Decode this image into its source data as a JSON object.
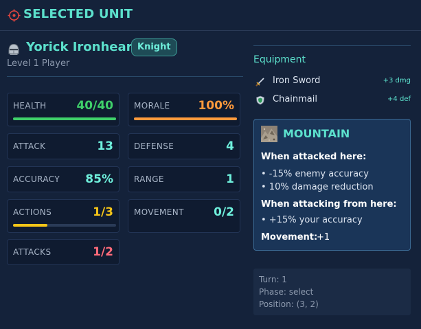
{
  "header": {
    "title": "SELECTED UNIT",
    "icon": "target-icon"
  },
  "unit": {
    "name": "Yorick Ironheart",
    "class_badge": "Knight",
    "subtitle": "Level 1 Player",
    "icon": "helmet-icon"
  },
  "stats": {
    "health": {
      "label": "HEALTH",
      "value": "40/40",
      "fraction": 1.0,
      "color": "#3fd06a"
    },
    "morale": {
      "label": "MORALE",
      "value": "100%",
      "fraction": 1.0,
      "color": "#ff9a3c"
    },
    "attack": {
      "label": "ATTACK",
      "value": "13",
      "color": "#6ff0dc"
    },
    "defense": {
      "label": "DEFENSE",
      "value": "4",
      "color": "#6ff0dc"
    },
    "accuracy": {
      "label": "ACCURACY",
      "value": "85%",
      "color": "#6ff0dc"
    },
    "range": {
      "label": "RANGE",
      "value": "1",
      "color": "#6ff0dc"
    },
    "actions": {
      "label": "ACTIONS",
      "value": "1/3",
      "fraction": 0.333,
      "color": "#f5c518"
    },
    "movement": {
      "label": "MOVEMENT",
      "value": "0/2",
      "color": "#6ff0dc"
    },
    "attacks": {
      "label": "ATTACKS",
      "value": "1/2",
      "color": "#ff6b7a"
    }
  },
  "equipment": {
    "title": "Equipment",
    "items": [
      {
        "name": "Iron Sword",
        "bonus": "+3 dmg",
        "icon": "sword-icon"
      },
      {
        "name": "Chainmail",
        "bonus": "+4 def",
        "icon": "shield-icon"
      }
    ]
  },
  "terrain": {
    "name": "MOUNTAIN",
    "icon": "mountain-tile-icon",
    "attacked_heading": "When attacked here:",
    "attacked_items": [
      "• -15% enemy accuracy",
      "• 10% damage reduction"
    ],
    "attacking_heading": "When attacking from here:",
    "attacking_items": [
      "• +15% your accuracy"
    ],
    "movement_label": "Movement:",
    "movement_value": "+1"
  },
  "game_info": {
    "turn": "Turn: 1",
    "phase": "Phase: select",
    "position": "Position: (3, 2)"
  }
}
